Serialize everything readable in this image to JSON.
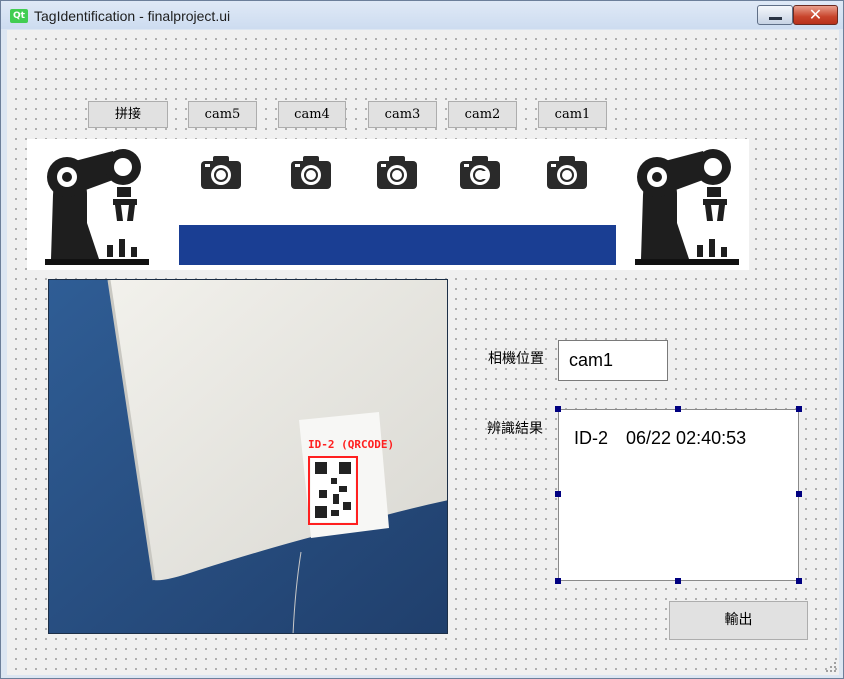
{
  "window": {
    "title": "TagIdentification - finalproject.ui",
    "logo_text": "Qt",
    "close_glyph": "✕"
  },
  "toolbar": {
    "buttons": [
      {
        "id": "stitch",
        "label": "拼接"
      },
      {
        "id": "cam5",
        "label": "cam5"
      },
      {
        "id": "cam4",
        "label": "cam4"
      },
      {
        "id": "cam3",
        "label": "cam3"
      },
      {
        "id": "cam2",
        "label": "cam2"
      },
      {
        "id": "cam1",
        "label": "cam1"
      }
    ]
  },
  "banner": {
    "left_icon": "robot-arm-icon",
    "right_icon": "robot-arm-icon",
    "camera_icons": [
      "camera-icon",
      "camera-icon",
      "camera-icon",
      "camera-icon",
      "camera-icon"
    ],
    "bar_color": "#1a3e93"
  },
  "camera_view": {
    "detection_label": "ID-2 (QRCODE)",
    "box_color": "#ff2020"
  },
  "form": {
    "camera_position_label": "相機位置",
    "camera_position_value": "cam1",
    "result_label": "辨識結果",
    "result_id": "ID-2",
    "result_timestamp": "06/22 02:40:53",
    "export_label": "輸出"
  }
}
